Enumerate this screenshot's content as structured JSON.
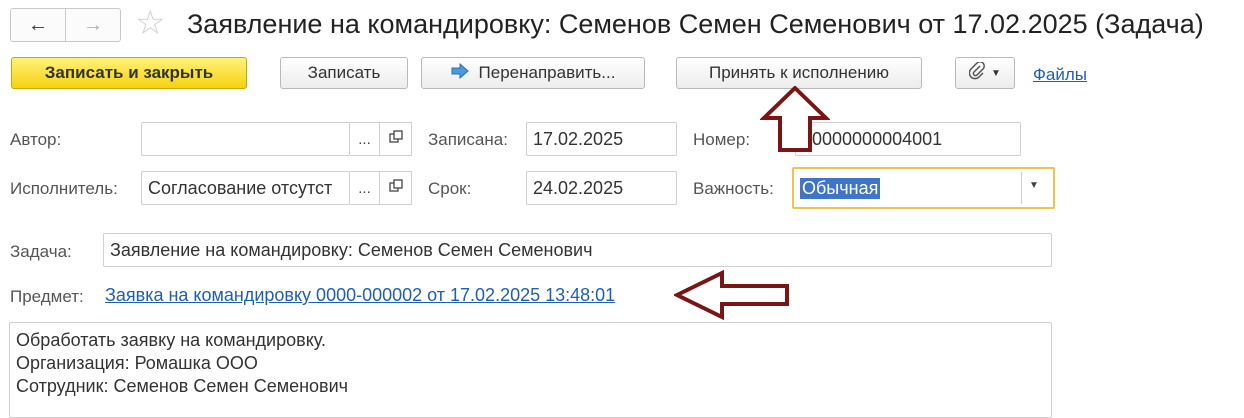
{
  "nav": {
    "back_icon": "arrow-left-icon",
    "forward_icon": "arrow-right-icon"
  },
  "favorite_icon": "star-icon",
  "title": "Заявление на командировку: Семенов Семен Семенович от 17.02.2025 (Задача)",
  "toolbar": {
    "save_close_label": "Записать и закрыть",
    "save_label": "Записать",
    "redirect_label": "Перенаправить...",
    "accept_label": "Принять к исполнению",
    "files_label": "Файлы"
  },
  "form": {
    "author_label": "Автор:",
    "author_value": "",
    "recorded_label": "Записана:",
    "recorded_value": "17.02.2025",
    "number_label": "Номер:",
    "number_value": "0000000004001",
    "executor_label": "Исполнитель:",
    "executor_value": "Согласование отсутст",
    "deadline_label": "Срок:",
    "deadline_value": "24.02.2025",
    "importance_label": "Важность:",
    "importance_value": "Обычная",
    "task_label": "Задача:",
    "task_value": "Заявление на командировку: Семенов Семен Семенович",
    "subject_label": "Предмет:",
    "subject_link": "Заявка на командировку 0000-000002 от 17.02.2025 13:48:01",
    "description_lines": [
      "Обработать заявку на командировку.",
      "Организация: Ромашка ООО",
      "Сотрудник: Семенов Семен Семенович"
    ],
    "choice_button": "...",
    "open_button_icon": "open-form-icon",
    "dropdown_icon": "chevron-down-icon"
  },
  "annotation_color": "#7a1515"
}
